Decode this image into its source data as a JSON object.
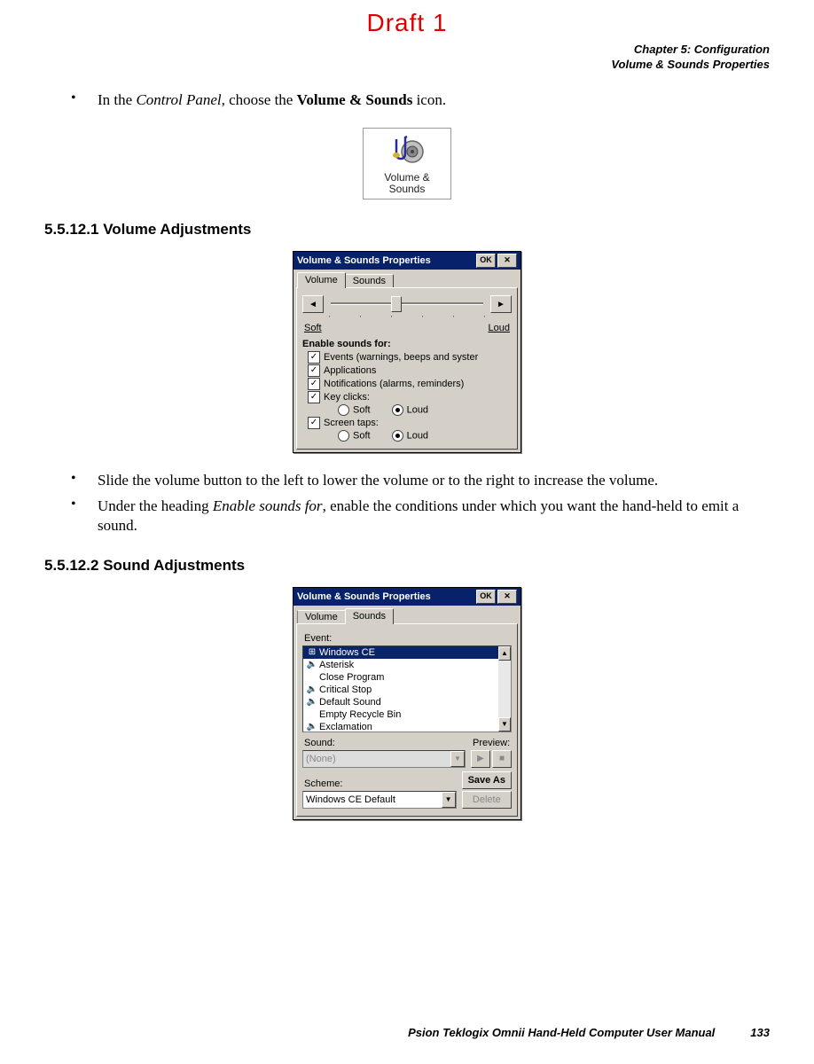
{
  "draft_label": "Draft 1",
  "header": {
    "line1": "Chapter 5: Configuration",
    "line2": "Volume & Sounds Properties"
  },
  "intro_bullet": {
    "prefix": "In the ",
    "em1": "Control Panel",
    "mid": ", choose the ",
    "bold1": "Volume & Sounds",
    "suffix": " icon."
  },
  "icon": {
    "line1": "Volume &",
    "line2": "Sounds"
  },
  "section1": {
    "num": "5.5.12.1",
    "title": "Volume Adjustments"
  },
  "dialog1": {
    "title": "Volume & Sounds Properties",
    "ok": "OK",
    "tab_volume": "Volume",
    "tab_sounds": "Sounds",
    "soft": "Soft",
    "loud": "Loud",
    "enable_header": "Enable sounds for:",
    "chk_events": "Events (warnings, beeps and syster",
    "chk_apps": "Applications",
    "chk_notif": "Notifications (alarms, reminders)",
    "chk_key": "Key clicks:",
    "chk_screen": "Screen taps:",
    "radio_soft": "Soft",
    "radio_loud": "Loud"
  },
  "bullets2": {
    "b1": "Slide the volume button to the left to lower the volume or to the right to increase the volume.",
    "b2_pre": "Under the heading ",
    "b2_em": "Enable sounds for",
    "b2_post": ", enable the conditions under which you want the hand-held to emit a sound."
  },
  "section2": {
    "num": "5.5.12.2",
    "title": "Sound Adjustments"
  },
  "dialog2": {
    "title": "Volume & Sounds Properties",
    "ok": "OK",
    "tab_volume": "Volume",
    "tab_sounds": "Sounds",
    "event_label": "Event:",
    "events": [
      "Windows CE",
      "Asterisk",
      "Close Program",
      "Critical Stop",
      "Default Sound",
      "Empty Recycle Bin",
      "Exclamation"
    ],
    "sound_label": "Sound:",
    "preview_label": "Preview:",
    "sound_value": "(None)",
    "scheme_label": "Scheme:",
    "scheme_value": "Windows CE Default",
    "save_as": "Save As",
    "delete": "Delete"
  },
  "footer": {
    "text": "Psion Teklogix Omnii Hand-Held Computer User Manual",
    "page": "133"
  }
}
